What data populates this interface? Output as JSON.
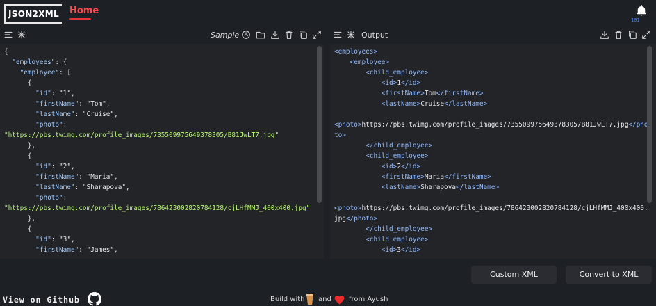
{
  "header": {
    "logo_text": "JSON2XML",
    "nav_home": "Home",
    "notification_badge": "101"
  },
  "left_panel": {
    "title": "Sample",
    "icons": [
      "list-icon",
      "format-icon",
      "history-icon",
      "open-folder-icon",
      "download-icon",
      "delete-icon",
      "copy-icon",
      "expand-icon"
    ]
  },
  "right_panel": {
    "title": "Output",
    "icons": [
      "list-icon",
      "format-icon",
      "download-icon",
      "delete-icon",
      "copy-icon",
      "expand-icon"
    ]
  },
  "json_lines": [
    "{",
    "  \"employees\": {",
    "    \"employee\": [",
    "      {",
    "        \"id\": \"1\",",
    "        \"firstName\": \"Tom\",",
    "        \"lastName\": \"Cruise\",",
    "        \"photo\":",
    "\"https://pbs.twimg.com/profile_images/735509975649378305/B81JwLT7.jpg\"",
    "      },",
    "      {",
    "        \"id\": \"2\",",
    "        \"firstName\": \"Maria\",",
    "        \"lastName\": \"Sharapova\",",
    "        \"photo\":",
    "\"https://pbs.twimg.com/profile_images/786423002820784128/cjLHfMMJ_400x400.jpg\"",
    "      },",
    "      {",
    "        \"id\": \"3\",",
    "        \"firstName\": \"James\","
  ],
  "xml_lines": [
    "<employees>",
    "    <employee>",
    "        <child_employee>",
    "            <id>1</id>",
    "            <firstName>Tom</firstName>",
    "            <lastName>Cruise</lastName>",
    "",
    "<photo>https://pbs.twimg.com/profile_images/735509975649378305/B81JwLT7.jpg</photo>",
    "        </child_employee>",
    "        <child_employee>",
    "            <id>2</id>",
    "            <firstName>Maria</firstName>",
    "            <lastName>Sharapova</lastName>",
    "",
    "<photo>https://pbs.twimg.com/profile_images/786423002820784128/cjLHfMMJ_400x400.jpg</photo>",
    "        </child_employee>",
    "        <child_employee>",
    "            <id>3</id>"
  ],
  "buttons": {
    "custom_xml": "Custom XML",
    "convert_to_xml": "Convert to XML"
  },
  "footer": {
    "github_text": "View on Github",
    "build_with": "Build with",
    "and": "and",
    "from": "from Ayush"
  }
}
